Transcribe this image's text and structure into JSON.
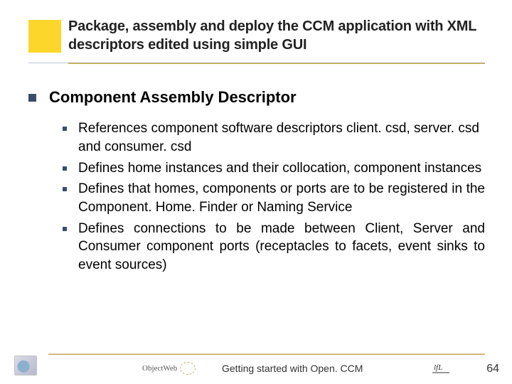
{
  "title": {
    "line": "Package, assembly and deploy the CCM application with XML descriptors edited using simple GUI"
  },
  "section": {
    "heading": "Component Assembly Descriptor",
    "items": [
      "References component software descriptors client. csd, server. csd and consumer. csd",
      "Defines home instances and their collocation, component instances",
      "Defines that homes, components or ports are to be registered in the Component. Home. Finder or Naming Service",
      "Defines connections to be made between Client, Server and Consumer component ports (receptacles to facets, event sinks to event sources)"
    ]
  },
  "footer": {
    "logo_text": "ObjectWeb",
    "center": "Getting started with Open. CCM",
    "page": "64"
  },
  "icons": {
    "title_square": "accent-square-icon",
    "section_bullet": "square-bullet-icon",
    "item_bullet": "small-square-icon",
    "footer_left": "globe-icon",
    "logo_swirl": "swirl-icon",
    "footer_right": "lfl-logo-icon"
  },
  "colors": {
    "accent_yellow": "#fcd62a",
    "bullet_navy": "#3b4d6b",
    "rule_gold": "#caa85b"
  }
}
